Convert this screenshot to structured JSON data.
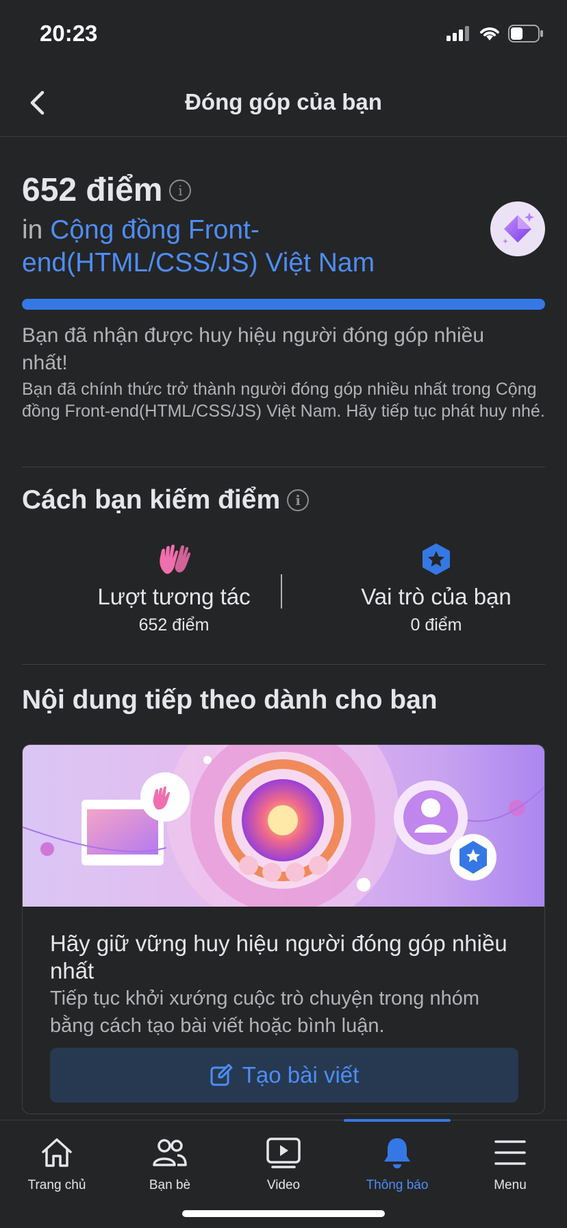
{
  "status_bar": {
    "time": "20:23",
    "battery_level": 0.45
  },
  "header": {
    "title": "Đóng góp của bạn"
  },
  "summary": {
    "points": "652 điểm",
    "in_prefix": "in",
    "group_name": "Cộng đồng Front-end(HTML/CSS/JS) Việt Nam",
    "progress": 1.0,
    "badge_title": "Bạn đã nhận được huy hiệu người đóng góp nhiều nhất!",
    "badge_body": "Bạn đã chính thức trở thành người đóng góp nhiều nhất trong Cộng đồng Front-end(HTML/CSS/JS) Việt Nam. Hãy tiếp tục phát huy nhé."
  },
  "earn": {
    "title": "Cách bạn kiếm điểm",
    "stats": [
      {
        "label": "Lượt tương tác",
        "value": "652 điểm",
        "icon": "high-five-icon"
      },
      {
        "label": "Vai trò của bạn",
        "value": "0 điểm",
        "icon": "role-star-icon"
      }
    ]
  },
  "next": {
    "title": "Nội dung tiếp theo dành cho bạn",
    "card_title": "Hãy giữ vững huy hiệu người đóng góp nhiều nhất",
    "card_desc": "Tiếp tục khởi xướng cuộc trò chuyện trong nhóm bằng cách tạo bài viết hoặc bình luận.",
    "button_label": "Tạo bài viết"
  },
  "tabs": [
    {
      "label": "Trang chủ",
      "icon": "home-icon",
      "active": false
    },
    {
      "label": "Bạn bè",
      "icon": "friends-icon",
      "active": false
    },
    {
      "label": "Video",
      "icon": "video-icon",
      "active": false
    },
    {
      "label": "Thông báo",
      "icon": "bell-icon",
      "active": true
    },
    {
      "label": "Menu",
      "icon": "menu-icon",
      "active": false
    }
  ],
  "colors": {
    "accent": "#3578e5",
    "link": "#4e8df5",
    "background": "#242526"
  }
}
